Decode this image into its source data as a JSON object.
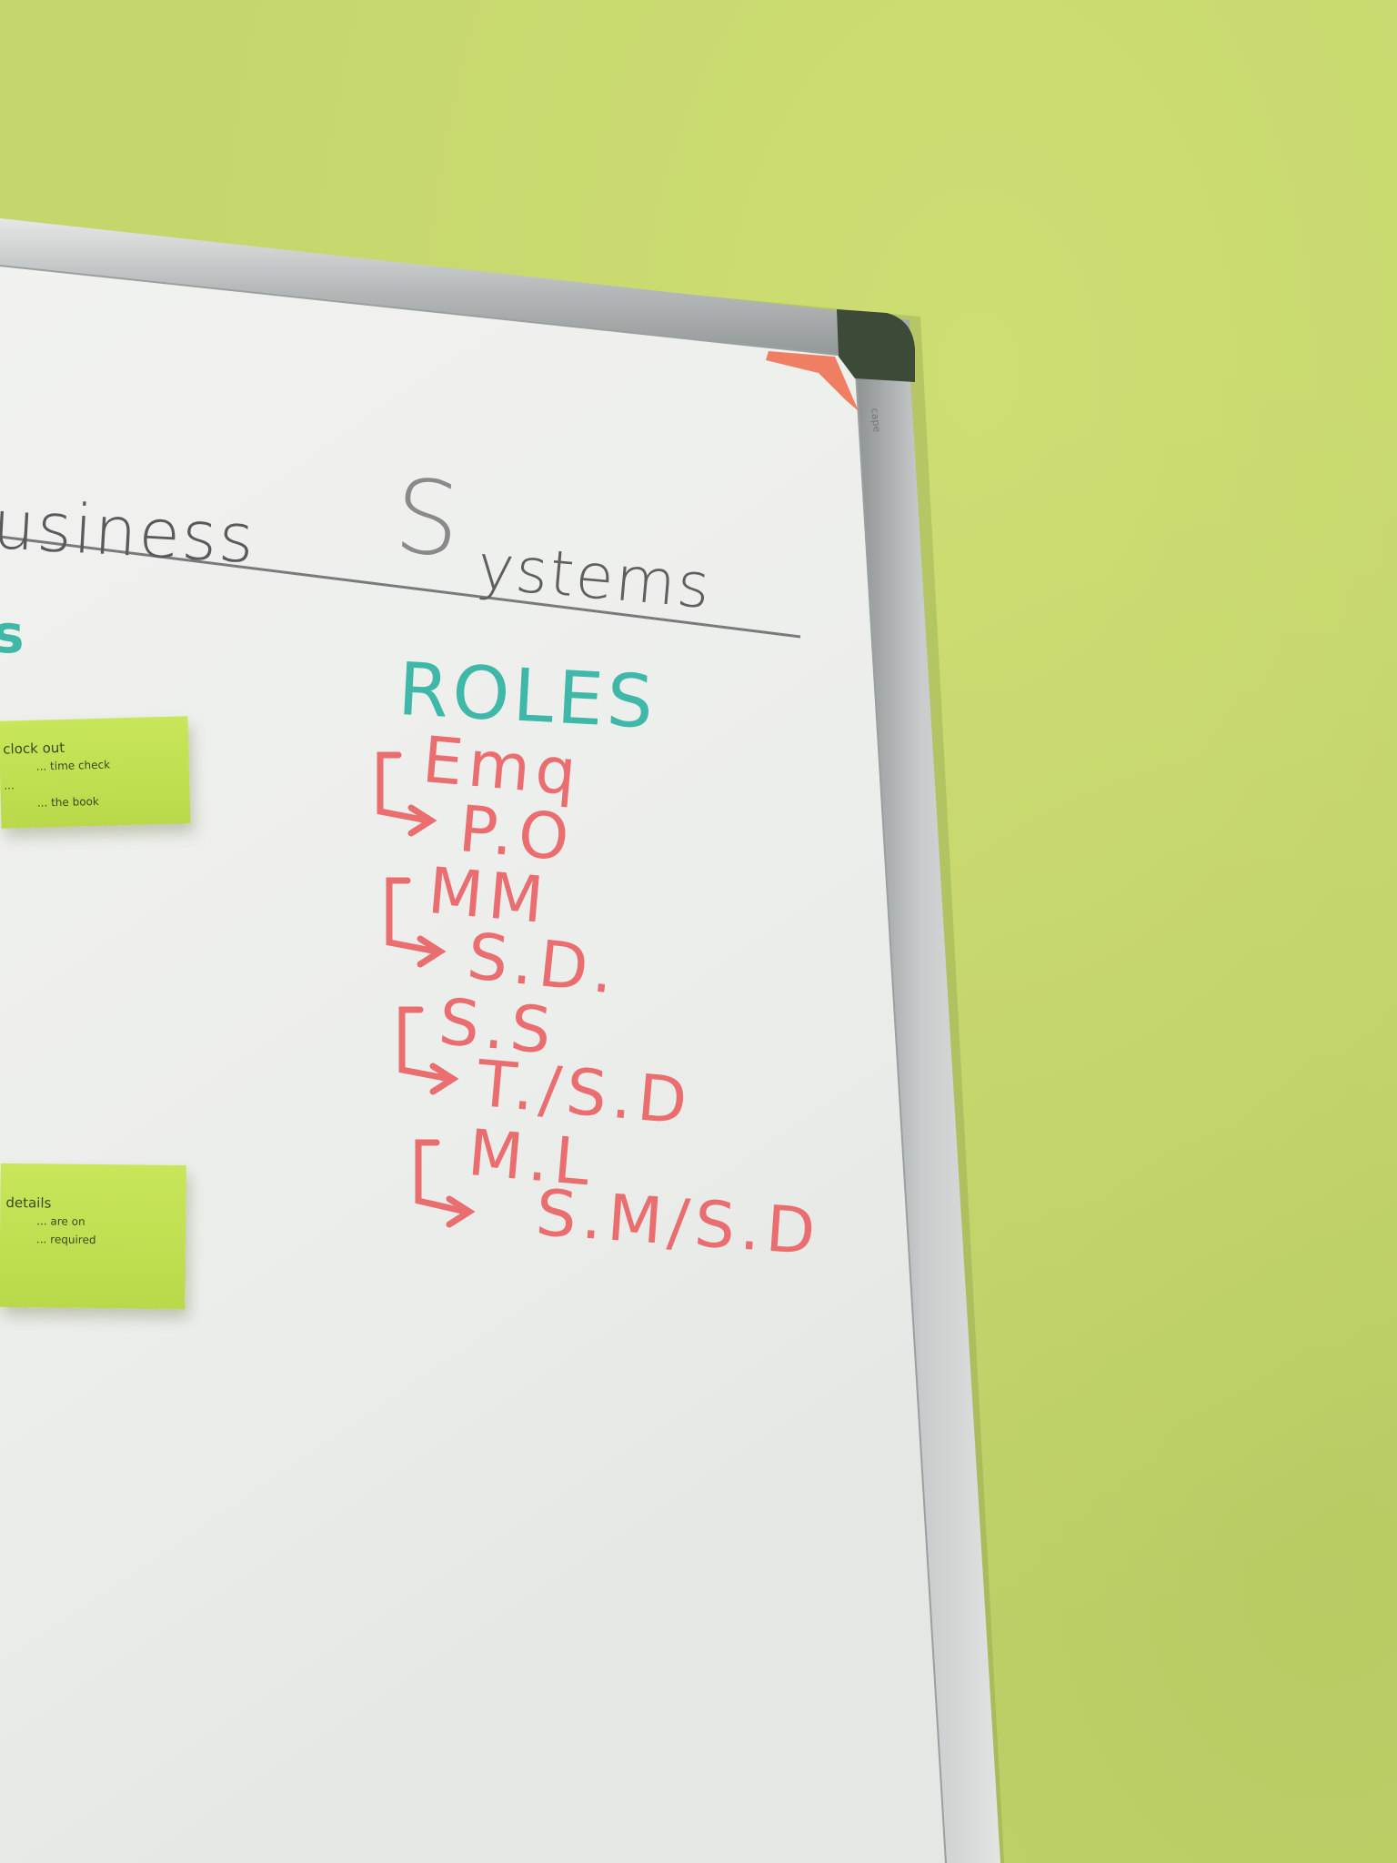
{
  "board": {
    "title_part1": "usiness",
    "title_part2": "S",
    "title_part3": "ystems",
    "teal_edge_text": "s",
    "brand": "cape"
  },
  "roles": {
    "heading": "ROLES",
    "items": [
      {
        "role": "Emq",
        "mapping": "P.O"
      },
      {
        "role": "MM",
        "mapping": "S.D."
      },
      {
        "role": "S.S",
        "mapping": "T./S.D"
      },
      {
        "role": "M.L",
        "mapping": "S.M/S.D"
      }
    ]
  },
  "sticky_notes": [
    {
      "lines": [
        "clock out",
        "... time check",
        "...",
        "... the book"
      ]
    },
    {
      "lines": [
        "details",
        "... are on",
        "... required"
      ]
    }
  ],
  "colors": {
    "wall": "#c4d66c",
    "board": "#f0f1ee",
    "frame": "#b9bcbc",
    "teal_marker": "#3fb8aa",
    "red_marker": "#ea6d70",
    "gray_marker": "#6a6a6a",
    "sticky": "#c9e65a",
    "corner_cap": "#3d4a38",
    "tape": "#ef6a4a"
  }
}
